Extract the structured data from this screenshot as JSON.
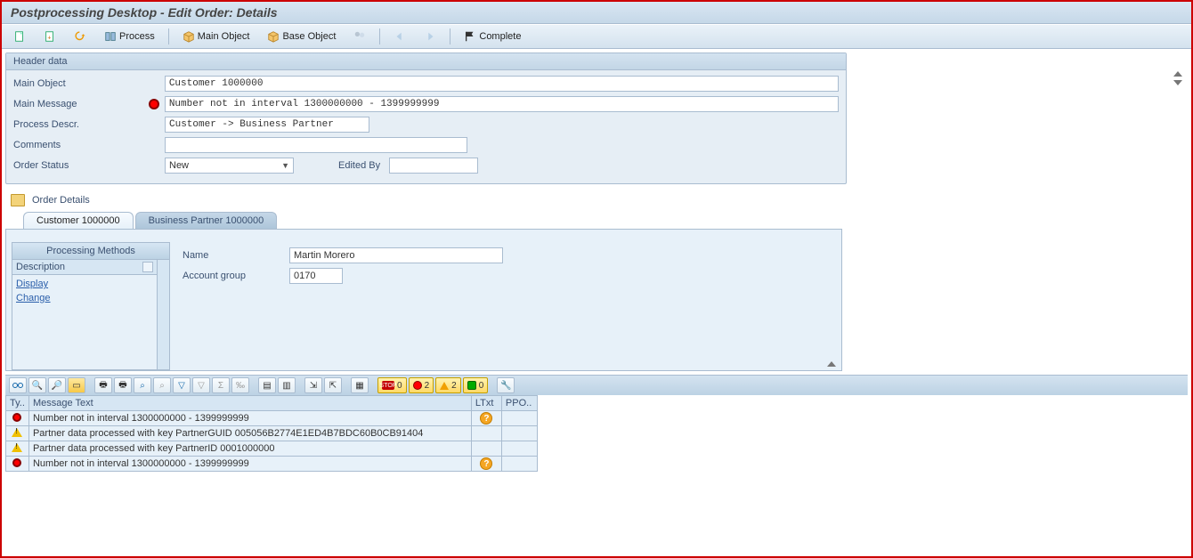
{
  "title": "Postprocessing Desktop - Edit Order: Details",
  "toolbar": {
    "process": "Process",
    "main_object": "Main Object",
    "base_object": "Base Object",
    "complete": "Complete"
  },
  "header": {
    "panel_title": "Header data",
    "labels": {
      "main_object": "Main Object",
      "main_message": "Main Message",
      "process_descr": "Process Descr.",
      "comments": "Comments",
      "order_status": "Order Status",
      "edited_by": "Edited By"
    },
    "values": {
      "main_object": "Customer 1000000",
      "main_message": "Number not in interval 1300000000 - 1399999999",
      "process_descr": "Customer -> Business Partner",
      "comments": "",
      "order_status": "New",
      "edited_by": ""
    }
  },
  "order_details_label": "Order Details",
  "tabs": [
    {
      "label": "Customer 1000000",
      "active": true
    },
    {
      "label": "Business Partner 1000000",
      "active": false
    }
  ],
  "processing_methods": {
    "title": "Processing Methods",
    "col": "Description",
    "items": [
      "Display",
      "Change"
    ]
  },
  "customer": {
    "labels": {
      "name": "Name",
      "account_group": "Account group"
    },
    "values": {
      "name": "Martin Morero",
      "account_group": "0170"
    }
  },
  "badges": {
    "stop": "0",
    "error": "2",
    "warn": "2",
    "ok": "0"
  },
  "messages": {
    "columns": {
      "type": "Ty..",
      "text": "Message Text",
      "ltxt": "LTxt",
      "ppo": "PPO.."
    },
    "rows": [
      {
        "type": "error",
        "text": "Number not in interval 1300000000 - 1399999999",
        "ltxt": true
      },
      {
        "type": "warn",
        "text": "Partner data processed with key PartnerGUID 005056B2774E1ED4B7BDC60B0CB91404",
        "ltxt": false
      },
      {
        "type": "warn",
        "text": "Partner data processed with key PartnerID 0001000000",
        "ltxt": false
      },
      {
        "type": "error",
        "text": "Number not in interval 1300000000 - 1399999999",
        "ltxt": true
      }
    ]
  }
}
